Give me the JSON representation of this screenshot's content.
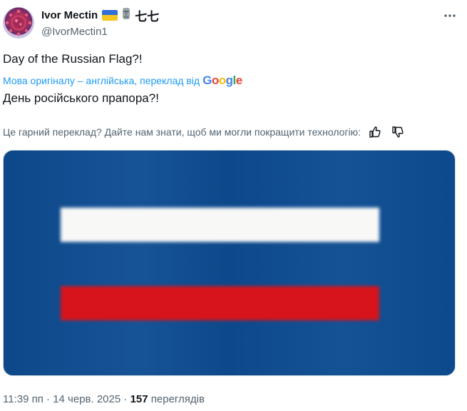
{
  "author": {
    "display_name": "Ivor Mectin",
    "handle": "@IvorMectin1",
    "name_suffix": "七七",
    "avatar_icon": "coronavirus-avatar",
    "flag_colors": [
      "#2f6fd6",
      "#f7c623"
    ]
  },
  "tweet": {
    "text": "Day of the Russian Flag?!",
    "translation_note": "Мова оригіналу – англійська, переклад від",
    "translation_provider": "Google",
    "translated_text": "День російського прапора?!",
    "feedback_prompt": "Це гарний переклад? Дайте нам знати, щоб ми могли покращити технологію:"
  },
  "media": {
    "background_color": "#0d4c92",
    "stripe_colors": [
      "#f8f8f6",
      "#d7141c"
    ]
  },
  "meta": {
    "time": "11:39 пп",
    "separator": "·",
    "date": "14 черв. 2025",
    "views_count": "157",
    "views_label": "переглядів"
  },
  "colors": {
    "link": "#1d9bf0",
    "secondary_text": "#536471",
    "primary_text": "#0f1419"
  }
}
